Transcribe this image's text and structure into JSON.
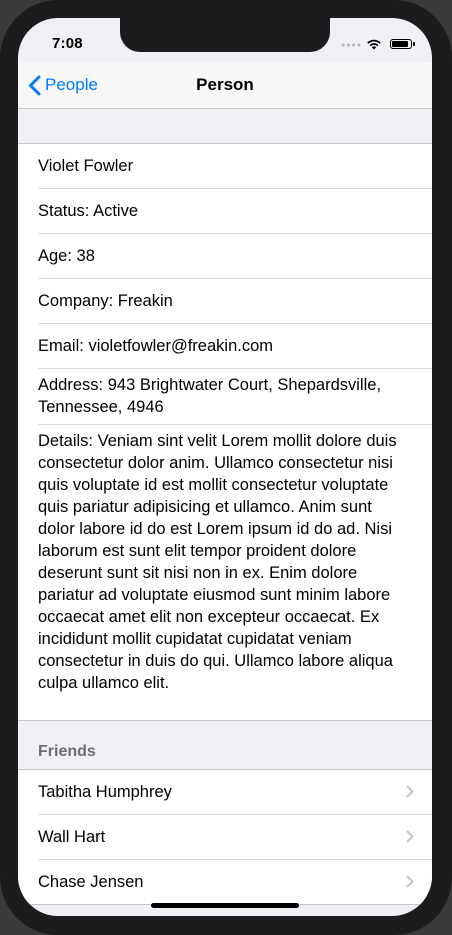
{
  "status_bar": {
    "time": "7:08",
    "signal_icon": "signal-dots-icon",
    "wifi_icon": "wifi-icon",
    "battery_icon": "battery-icon"
  },
  "navbar": {
    "back_label": "People",
    "title": "Person",
    "accent_color": "#007aff"
  },
  "person": {
    "name": "Violet Fowler",
    "status_label": "Status:",
    "status": "Active",
    "age_label": "Age:",
    "age": "38",
    "company_label": "Company:",
    "company": "Freakin",
    "email_label": "Email:",
    "email": "violetfowler@freakin.com",
    "address_label": "Address:",
    "address": "943 Brightwater Court, Shepardsville, Tennessee, 4946",
    "details_label": "Details:",
    "details": "Veniam sint velit Lorem mollit dolore duis consectetur dolor anim. Ullamco consectetur nisi quis voluptate id est mollit consectetur voluptate quis pariatur adipisicing et ullamco. Anim sunt dolor labore id do est Lorem ipsum id do ad. Nisi laborum est sunt elit tempor proident dolore deserunt sunt sit nisi non in ex. Enim dolore pariatur ad voluptate eiusmod sunt minim labore occaecat amet elit non excepteur occaecat. Ex incididunt mollit cupidatat cupidatat veniam consectetur in duis do qui. Ullamco labore aliqua culpa ullamco elit."
  },
  "friends": {
    "header": "Friends",
    "items": [
      {
        "name": "Tabitha Humphrey"
      },
      {
        "name": "Wall Hart"
      },
      {
        "name": "Chase Jensen"
      }
    ]
  }
}
